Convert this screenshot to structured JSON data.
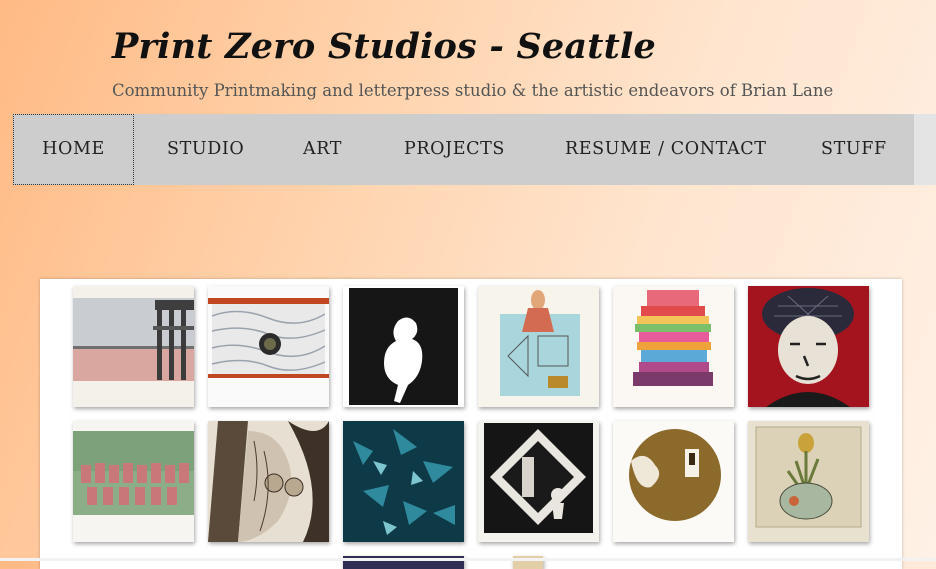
{
  "site": {
    "title": "Print Zero Studios - Seattle",
    "tagline": "Community Printmaking and letterpress studio & the artistic endeavors of Brian Lane"
  },
  "nav": {
    "items": [
      "HOME",
      "STUDIO",
      "ART",
      "PROJECTS",
      "RESUME / CONTACT",
      "STUFF"
    ],
    "active": "HOME"
  },
  "gallery": {
    "thumbnails": [
      "pier-landscape-print",
      "white-relief-print-with-coin",
      "black-silhouette-print",
      "collage-print-with-figure",
      "stacked-colorful-blocks-print",
      "portrait-woman-in-hat-print",
      "group-photo-print",
      "figure-etching",
      "blue-abstract-print",
      "woodcut-with-skeleton",
      "circular-landscape-etching",
      "plant-in-bowl-etching"
    ]
  },
  "colors": {
    "header_gradient_start": "#ffba85",
    "header_gradient_end": "#fff1e6",
    "nav_background": "#cdcdcd"
  }
}
